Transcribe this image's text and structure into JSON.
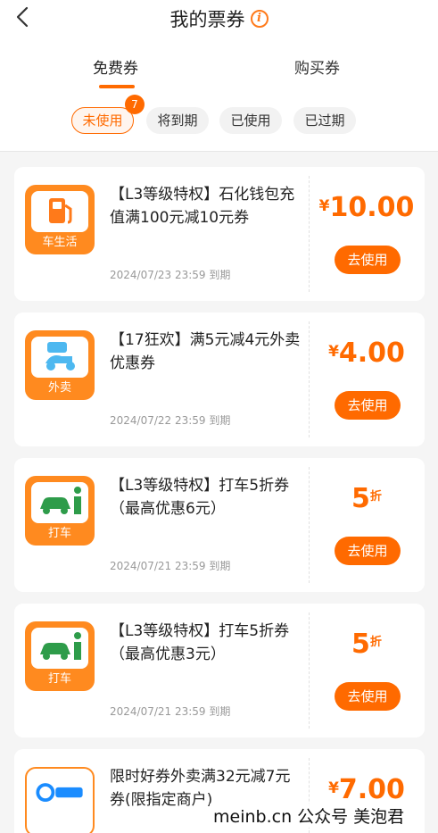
{
  "header": {
    "title": "我的票券",
    "info_glyph": "i",
    "tabs": [
      {
        "label": "免费券",
        "active": true
      },
      {
        "label": "购买券",
        "active": false
      }
    ],
    "filters": [
      {
        "label": "未使用",
        "active": true
      },
      {
        "label": "将到期",
        "active": false
      },
      {
        "label": "已使用",
        "active": false
      },
      {
        "label": "已过期",
        "active": false
      }
    ],
    "unused_count": "7"
  },
  "colors": {
    "accent": "#ff6a00",
    "icon_bg": "#ff8a1f"
  },
  "coupons": [
    {
      "icon": "gas-pump-icon",
      "icon_label": "车生活",
      "title": "【L3等级特权】石化钱包充值满100元减10元券",
      "expiry": "2024/07/23 23:59 到期",
      "currency": "¥",
      "amount": "10.00",
      "unit": "",
      "button": "去使用"
    },
    {
      "icon": "scooter-icon",
      "icon_label": "外卖",
      "title": "【17狂欢】满5元减4元外卖优惠券",
      "expiry": "2024/07/22 23:59 到期",
      "currency": "¥",
      "amount": "4.00",
      "unit": "",
      "button": "去使用"
    },
    {
      "icon": "taxi-icon",
      "icon_label": "打车",
      "title": "【L3等级特权】打车5折券（最高优惠6元）",
      "expiry": "2024/07/21 23:59 到期",
      "currency": "",
      "amount": "5",
      "unit": "折",
      "button": "去使用"
    },
    {
      "icon": "taxi-icon",
      "icon_label": "打车",
      "title": "【L3等级特权】打车5折券（最高优惠3元）",
      "expiry": "2024/07/21 23:59 到期",
      "currency": "",
      "amount": "5",
      "unit": "折",
      "button": "去使用"
    },
    {
      "icon": "eleme-logo-icon",
      "icon_label": "",
      "title": "限时好券外卖满32元减7元券(限指定商户)",
      "expiry": "",
      "currency": "¥",
      "amount": "7.00",
      "unit": "",
      "button": ""
    }
  ],
  "watermark": "meinb.cn 公众号 美泡君"
}
